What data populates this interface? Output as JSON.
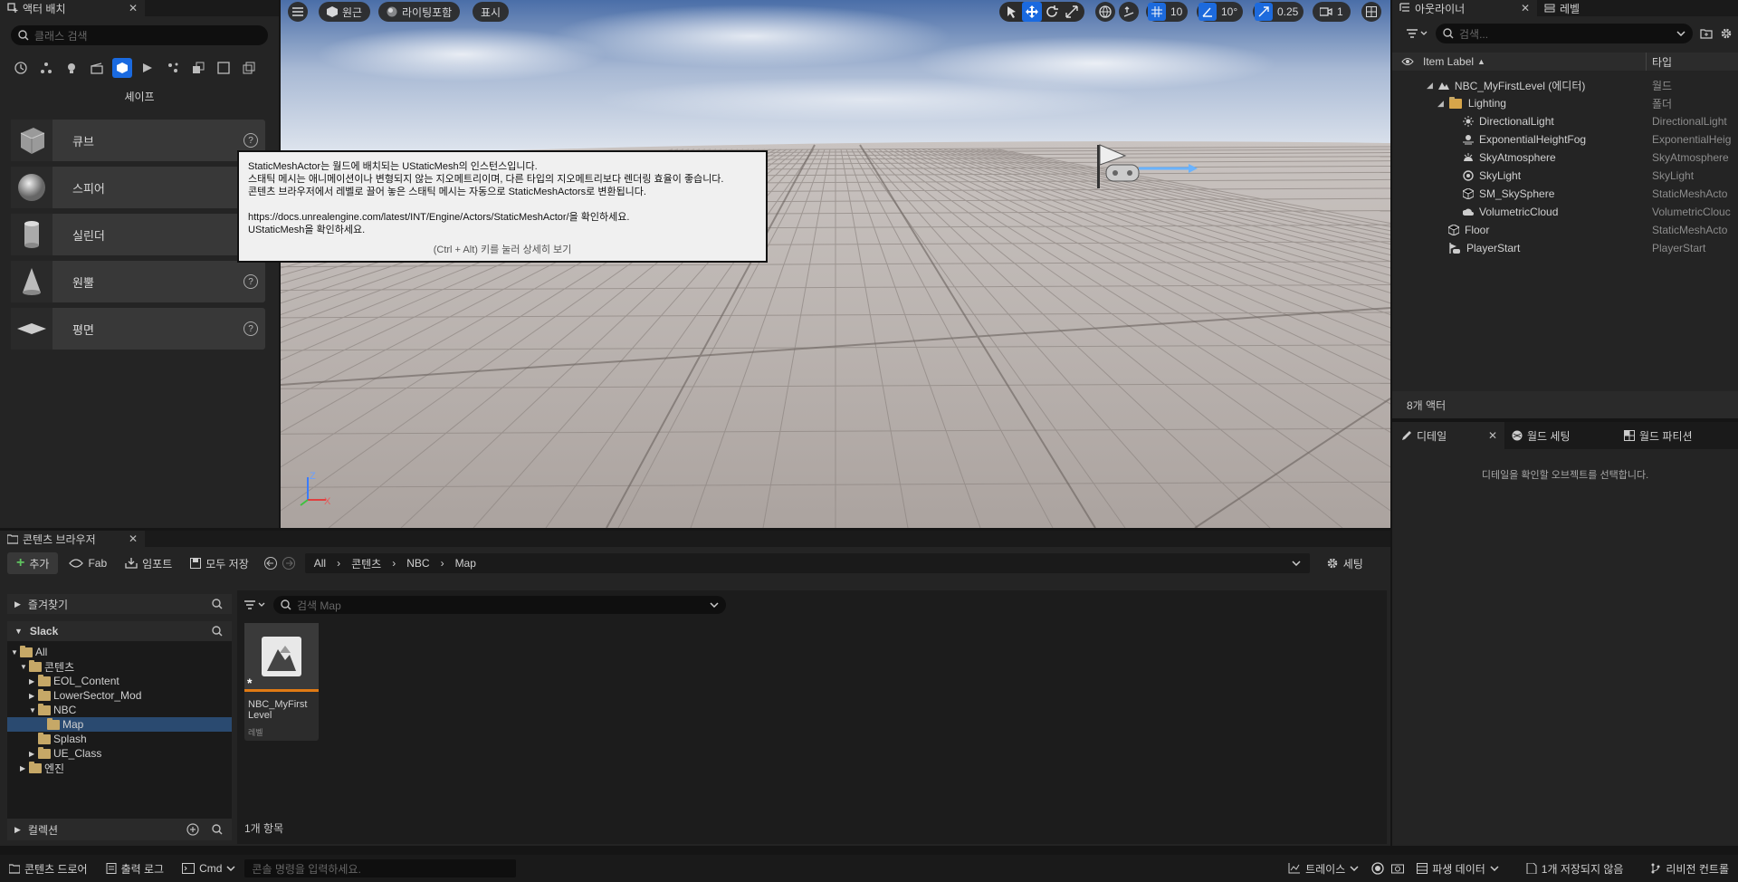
{
  "place_actors": {
    "tab_title": "액터 배치",
    "search_placeholder": "클래스 검색",
    "category_title": "셰이프",
    "shapes": [
      {
        "label": "큐브"
      },
      {
        "label": "스피어"
      },
      {
        "label": "실린더"
      },
      {
        "label": "원뿔"
      },
      {
        "label": "평면"
      }
    ]
  },
  "viewport": {
    "menu_icon": "hamburger-icon",
    "perspective_label": "원근",
    "lighting_label": "라이팅포함",
    "show_label": "표시",
    "grid_snap_value": "10",
    "rotation_snap_value": "10°",
    "scale_snap_value": "0.25",
    "camera_speed_value": "1",
    "axis_z": "Z",
    "axis_x": "X"
  },
  "tooltip": {
    "line1": "StaticMeshActor는 월드에 배치되는 UStaticMesh의 인스턴스입니다.",
    "line2": "스태틱 메시는 애니메이션이나 변형되지 않는 지오메트리이며, 다른 타입의 지오메트리보다 렌더링 효율이 좋습니다.",
    "line3": "콘텐츠 브라우저에서 레벨로 끌어 놓은 스태틱 메시는 자동으로 StaticMeshActors로 변환됩니다.",
    "line4": "https://docs.unrealengine.com/latest/INT/Engine/Actors/StaticMeshActor/을 확인하세요.",
    "line5": "UStaticMesh을 확인하세요.",
    "hint": "(Ctrl + Alt) 키를 눌러 상세히 보기"
  },
  "outliner": {
    "tab_title": "아웃라이너",
    "tab2_title": "레벨",
    "search_placeholder": "검색...",
    "col_label": "Item Label",
    "col_type": "타입",
    "rows": [
      {
        "label": "NBC_MyFirstLevel (에디터)",
        "type": "월드"
      },
      {
        "label": "Lighting",
        "type": "폴더"
      },
      {
        "label": "DirectionalLight",
        "type": "DirectionalLight"
      },
      {
        "label": "ExponentialHeightFog",
        "type": "ExponentialHeig"
      },
      {
        "label": "SkyAtmosphere",
        "type": "SkyAtmosphere"
      },
      {
        "label": "SkyLight",
        "type": "SkyLight"
      },
      {
        "label": "SM_SkySphere",
        "type": "StaticMeshActo"
      },
      {
        "label": "VolumetricCloud",
        "type": "VolumetricClouc"
      },
      {
        "label": "Floor",
        "type": "StaticMeshActo"
      },
      {
        "label": "PlayerStart",
        "type": "PlayerStart"
      }
    ],
    "count": "8개 액터"
  },
  "details": {
    "tab_title": "디테일",
    "tab2_title": "월드 세팅",
    "tab3_title": "월드 파티션",
    "empty_message": "디테일을 확인할 오브젝트를 선택합니다."
  },
  "content_browser": {
    "tab_title": "콘텐츠 브라우저",
    "add_label": "추가",
    "fab_label": "Fab",
    "import_label": "임포트",
    "save_all_label": "모두 저장",
    "breadcrumb": [
      "All",
      "콘텐츠",
      "NBC",
      "Map"
    ],
    "settings_label": "세팅",
    "favorites_label": "즐겨찾기",
    "project_label": "Slack",
    "tree": [
      "All",
      "콘텐츠",
      "EOL_Content",
      "LowerSector_Mod",
      "NBC",
      "Map",
      "Splash",
      "UE_Class",
      "엔진"
    ],
    "collections_label": "컬렉션",
    "search_placeholder": "검색 Map",
    "asset_name": "NBC_MyFirst Level",
    "asset_type": "레벨",
    "asset_modified_mark": "*",
    "item_count": "1개 항목"
  },
  "status": {
    "drawer_label": "콘텐츠 드로어",
    "output_log_label": "출력 로그",
    "cmd_label": "Cmd",
    "console_placeholder": "콘솔 명령을 입력하세요.",
    "trace_label": "트레이스",
    "derived_data_label": "파생 데이터",
    "unsaved_label": "1개 저장되지 않음",
    "revision_label": "리비전 컨트롤"
  },
  "colors": {
    "accent": "#1a6ae0",
    "panel": "#242424",
    "background": "#151515",
    "folder": "#c6a867",
    "selection": "#2a4a70"
  }
}
